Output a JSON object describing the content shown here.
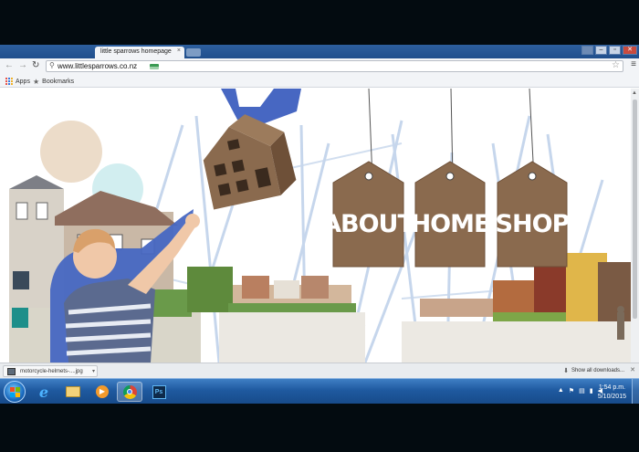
{
  "browser": {
    "tab_title": "little sparrows homepage",
    "tab_close": "×",
    "url": "www.littlesparrows.co.nz",
    "bookmarks": [
      {
        "label": "Apps",
        "icon": "apps-grid-icon"
      },
      {
        "label": "Bookmarks",
        "icon": "star-icon"
      }
    ]
  },
  "site": {
    "nav_tags": [
      {
        "label": "ABOUT"
      },
      {
        "label": "HOME"
      },
      {
        "label": "SHOP"
      }
    ],
    "colors": {
      "tag_cardboard": "#8a6a4e",
      "accent_blue": "#4767c2",
      "sky_lines": "#b8cde8"
    }
  },
  "downloads": {
    "file_name": "motorcycle-helmets-....jpg",
    "show_all": "Show all downloads..."
  },
  "taskbar": {
    "apps": [
      {
        "name": "internet-explorer"
      },
      {
        "name": "file-explorer"
      },
      {
        "name": "media-player"
      },
      {
        "name": "chrome",
        "active": true
      },
      {
        "name": "photoshop"
      }
    ],
    "photoshop_label": "Ps",
    "time": "1:54 p.m.",
    "date": "5/10/2015"
  }
}
